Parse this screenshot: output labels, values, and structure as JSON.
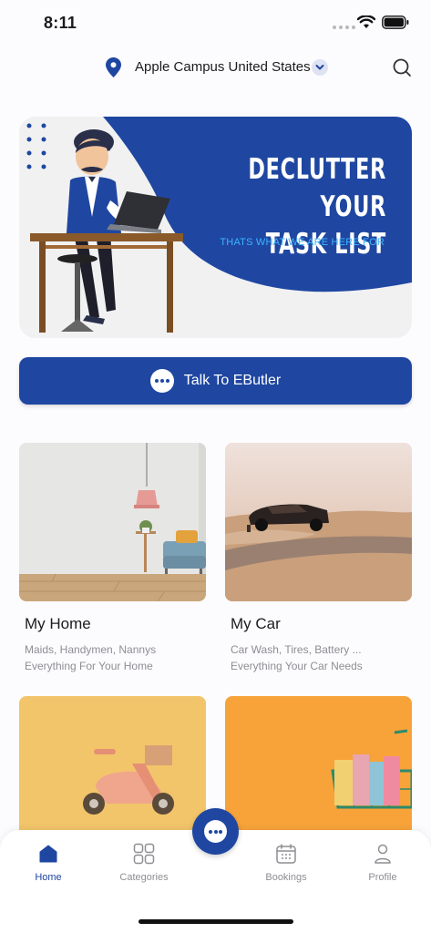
{
  "status_bar": {
    "time": "8:11"
  },
  "location": {
    "label": "Apple Campus United States"
  },
  "banner": {
    "title_line1": "DECLUTTER YOUR",
    "title_line2": "TASK LIST",
    "subtitle": "THATS WHAT WE ARE HERE FOR"
  },
  "talk_button": {
    "label": "Talk To EButler"
  },
  "cards": [
    {
      "title": "My Home",
      "line1": "Maids, Handymen, Nannys",
      "line2": "Everything For Your Home"
    },
    {
      "title": "My Car",
      "line1": "Car Wash, Tires, Battery ...",
      "line2": "Everything Your Car Needs"
    }
  ],
  "nav": [
    {
      "label": "Home",
      "icon": "home-icon",
      "active": true
    },
    {
      "label": "Categories",
      "icon": "grid-icon",
      "active": false
    },
    {
      "label": "Bookings",
      "icon": "calendar-icon",
      "active": false
    },
    {
      "label": "Profile",
      "icon": "user-icon",
      "active": false
    }
  ],
  "colors": {
    "brand": "#1f47a1",
    "accent": "#3bb4ff",
    "muted": "#8e8e93"
  }
}
